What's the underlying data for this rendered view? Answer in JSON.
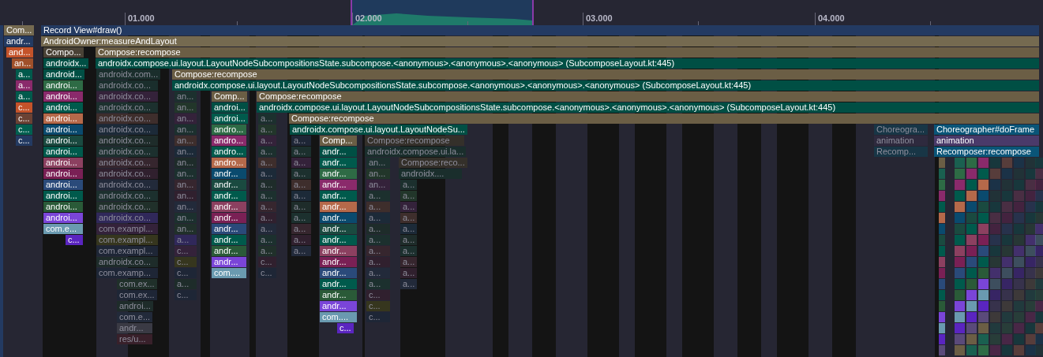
{
  "timeline": {
    "ticks": [
      "01.000",
      "02.000",
      "03.000",
      "04.000"
    ]
  },
  "columns": [
    {
      "frames": [
        {
          "label": "Com...",
          "color": "#756a50",
          "faded": false
        },
        {
          "label": "andr...",
          "color": "#233a62",
          "faded": false
        }
      ]
    },
    {
      "frames": [
        {
          "label": "Record View#draw()",
          "color": "#233a62",
          "faded": false
        },
        {
          "label": "AndroidOwner:measureAndLayout",
          "color": "#756a50",
          "faded": false
        }
      ]
    },
    {
      "frames": [
        {
          "label": "and...",
          "color": "#c4532a",
          "faded": false
        }
      ]
    },
    {
      "frames": [
        {
          "label": "an...",
          "color": "#a0502a",
          "faded": false
        }
      ]
    },
    {
      "frames": [
        {
          "label": "a...",
          "color": "#005a4c",
          "faded": false
        },
        {
          "label": "a...",
          "color": "#8a2a6b",
          "faded": false
        },
        {
          "label": "a...",
          "color": "#005a4c",
          "faded": false
        },
        {
          "label": "c...",
          "color": "#c4532a",
          "faded": false
        },
        {
          "label": "c...",
          "color": "#6b4234",
          "faded": false
        },
        {
          "label": "c...",
          "color": "#006050",
          "faded": false
        },
        {
          "label": "c...",
          "color": "#233a62",
          "faded": false
        }
      ]
    },
    {
      "frames": [
        {
          "label": "Compo...",
          "color": "#4a4236",
          "faded": false
        },
        {
          "label": "androidx...",
          "color": "#004f44",
          "faded": false
        },
        {
          "label": "android...",
          "color": "#004f44",
          "faded": false
        },
        {
          "label": "androi...",
          "color": "#2e6b45",
          "faded": false
        },
        {
          "label": "androi...",
          "color": "#8a2a6b",
          "faded": false
        },
        {
          "label": "androi...",
          "color": "#005a4c",
          "faded": false
        },
        {
          "label": "androi...",
          "color": "#b5694a",
          "faded": false
        },
        {
          "label": "androi...",
          "color": "#0a4a6e",
          "faded": false
        },
        {
          "label": "androi...",
          "color": "#1a4a40",
          "faded": false
        },
        {
          "label": "androi...",
          "color": "#005a4c",
          "faded": false
        },
        {
          "label": "androi...",
          "color": "#8c4060",
          "faded": false
        },
        {
          "label": "androi...",
          "color": "#7a2055",
          "faded": false
        },
        {
          "label": "androi...",
          "color": "#2a4a7a",
          "faded": false
        },
        {
          "label": "androi...",
          "color": "#005a4c",
          "faded": false
        },
        {
          "label": "androi...",
          "color": "#2a5a38",
          "faded": false
        },
        {
          "label": "androi...",
          "color": "#7a45d8",
          "faded": false
        },
        {
          "label": "com.e...",
          "color": "#6a9ab0",
          "faded": false
        }
      ]
    },
    {
      "frames": [
        {
          "label": "c...",
          "color": "#5a25c0",
          "faded": false
        }
      ]
    },
    {
      "frames": [
        {
          "label": "Compose:recompose",
          "color": "#6b5e45",
          "faded": false
        },
        {
          "label": "androidx.compose.ui.layout.LayoutNodeSubcompositionsState.subcompose.<anonymous>.<anonymous>.<anonymous> (SubcomposeLayout.kt:445)",
          "color": "#004f44",
          "faded": false
        }
      ]
    },
    {
      "frames": [
        {
          "label": "androidx.com...",
          "color": "#1a2e2c",
          "faded": true
        },
        {
          "label": "androidx.co...",
          "color": "#1a2e2c",
          "faded": true
        },
        {
          "label": "androidx.co...",
          "color": "#34223a",
          "faded": true
        },
        {
          "label": "androidx.co...",
          "color": "#1c302e",
          "faded": true
        },
        {
          "label": "androidx.co...",
          "color": "#3e2e2c",
          "faded": true
        },
        {
          "label": "androidx.co...",
          "color": "#1c2a38",
          "faded": true
        },
        {
          "label": "androidx.co...",
          "color": "#1e2c2a",
          "faded": true
        },
        {
          "label": "androidx.co...",
          "color": "#1c302e",
          "faded": true
        },
        {
          "label": "androidx.co...",
          "color": "#36262e",
          "faded": true
        },
        {
          "label": "androidx.co...",
          "color": "#30202e",
          "faded": true
        },
        {
          "label": "androidx.co...",
          "color": "#222a3a",
          "faded": true
        },
        {
          "label": "androidx.co...",
          "color": "#1c302e",
          "faded": true
        },
        {
          "label": "androidx.co...",
          "color": "#20302a",
          "faded": true
        },
        {
          "label": "androidx.co...",
          "color": "#30285a",
          "faded": true
        },
        {
          "label": "com.exampl...",
          "color": "#34223a",
          "faded": true
        },
        {
          "label": "com.exampl...",
          "color": "#36361e",
          "faded": true
        },
        {
          "label": "com.exampl...",
          "color": "#1e2636",
          "faded": true
        },
        {
          "label": "androidx.co...",
          "color": "#1e2c2a",
          "faded": true
        },
        {
          "label": "com.examp...",
          "color": "#1e2636",
          "faded": true
        }
      ]
    },
    {
      "frames": [
        {
          "label": "com.ex...",
          "color": "#20302a",
          "faded": true
        },
        {
          "label": "com.ex...",
          "color": "#1e2636",
          "faded": true
        },
        {
          "label": "androi...",
          "color": "#1e2c2a",
          "faded": true
        },
        {
          "label": "com.e...",
          "color": "#222a3a",
          "faded": true
        },
        {
          "label": "andr...",
          "color": "#3a3a44",
          "faded": true
        },
        {
          "label": "res/u...",
          "color": "#38202a",
          "faded": true
        }
      ]
    },
    {
      "frames": [
        {
          "label": "Compose:recompose",
          "color": "#6b5e45",
          "faded": false
        },
        {
          "label": "androidx.compose.ui.layout.LayoutNodeSubcompositionsState.subcompose.<anonymous>.<anonymous>.<anonymous> (SubcomposeLayout.kt:445)",
          "color": "#004f44",
          "faded": false
        }
      ]
    },
    {
      "frames": [
        {
          "label": "an...",
          "color": "#1c302e",
          "faded": true
        },
        {
          "label": "an...",
          "color": "#22362a",
          "faded": true
        },
        {
          "label": "an...",
          "color": "#34223a",
          "faded": true
        },
        {
          "label": "an...",
          "color": "#1c302e",
          "faded": true
        },
        {
          "label": "an...",
          "color": "#3e2e2c",
          "faded": true
        },
        {
          "label": "an...",
          "color": "#1c2a38",
          "faded": true
        },
        {
          "label": "an...",
          "color": "#1e2c2a",
          "faded": true
        },
        {
          "label": "an...",
          "color": "#1c302e",
          "faded": true
        },
        {
          "label": "an...",
          "color": "#36262e",
          "faded": true
        },
        {
          "label": "an...",
          "color": "#30202e",
          "faded": true
        },
        {
          "label": "an...",
          "color": "#222a3a",
          "faded": true
        },
        {
          "label": "an...",
          "color": "#1c302e",
          "faded": true
        },
        {
          "label": "an...",
          "color": "#20302a",
          "faded": true
        },
        {
          "label": "a...",
          "color": "#30285a",
          "faded": true
        },
        {
          "label": "c...",
          "color": "#34223a",
          "faded": true
        },
        {
          "label": "c...",
          "color": "#36361e",
          "faded": true
        },
        {
          "label": "c...",
          "color": "#1e2636",
          "faded": true
        },
        {
          "label": "a...",
          "color": "#1e2c2a",
          "faded": true
        },
        {
          "label": "c...",
          "color": "#1e2636",
          "faded": true
        }
      ]
    },
    {
      "frames": [
        {
          "label": "Comp...",
          "color": "#6b5e45",
          "faded": false
        },
        {
          "label": "androi...",
          "color": "#004f44",
          "faded": false
        },
        {
          "label": "androi...",
          "color": "#005a4c",
          "faded": false
        },
        {
          "label": "andro...",
          "color": "#2e6b45",
          "faded": false
        },
        {
          "label": "andro...",
          "color": "#8a2a6b",
          "faded": false
        },
        {
          "label": "andro...",
          "color": "#005a4c",
          "faded": false
        },
        {
          "label": "andro...",
          "color": "#b5694a",
          "faded": false
        },
        {
          "label": "andr...",
          "color": "#0a4a6e",
          "faded": false
        },
        {
          "label": "andr...",
          "color": "#1a4a40",
          "faded": false
        },
        {
          "label": "andr...",
          "color": "#005a4c",
          "faded": false
        },
        {
          "label": "andr...",
          "color": "#8c4060",
          "faded": false
        },
        {
          "label": "andr...",
          "color": "#7a2055",
          "faded": false
        },
        {
          "label": "andr...",
          "color": "#2a4a7a",
          "faded": false
        },
        {
          "label": "andr...",
          "color": "#005a4c",
          "faded": false
        },
        {
          "label": "andr...",
          "color": "#2a5a38",
          "faded": false
        },
        {
          "label": "andr...",
          "color": "#7a45d8",
          "faded": false
        },
        {
          "label": "com....",
          "color": "#6a9ab0",
          "faded": false
        }
      ]
    },
    {
      "frames": [
        {
          "label": "Compose:recompose",
          "color": "#6b5e45",
          "faded": false
        },
        {
          "label": "androidx.compose.ui.layout.LayoutNodeSubcompositionsState.subcompose.<anonymous>.<anonymous>.<anonymous> (SubcomposeLayout.kt:445)",
          "color": "#004f44",
          "faded": false
        }
      ]
    },
    {
      "frames": [
        {
          "label": "a...",
          "color": "#1c302e",
          "faded": true
        },
        {
          "label": "a...",
          "color": "#22362a",
          "faded": true
        },
        {
          "label": "a...",
          "color": "#34223a",
          "faded": true
        },
        {
          "label": "a...",
          "color": "#1c302e",
          "faded": true
        },
        {
          "label": "a...",
          "color": "#3e2e2c",
          "faded": true
        },
        {
          "label": "a...",
          "color": "#1c2a38",
          "faded": true
        },
        {
          "label": "a...",
          "color": "#1e2c2a",
          "faded": true
        },
        {
          "label": "a...",
          "color": "#1c302e",
          "faded": true
        },
        {
          "label": "a...",
          "color": "#36262e",
          "faded": true
        },
        {
          "label": "a...",
          "color": "#30202e",
          "faded": true
        },
        {
          "label": "a...",
          "color": "#222a3a",
          "faded": true
        },
        {
          "label": "a...",
          "color": "#1c302e",
          "faded": true
        },
        {
          "label": "a...",
          "color": "#20302a",
          "faded": true
        },
        {
          "label": "c...",
          "color": "#30202e",
          "faded": true
        },
        {
          "label": "c...",
          "color": "#1e2636",
          "faded": true
        }
      ]
    },
    {
      "frames": [
        {
          "label": "Compose:recompose",
          "color": "#6b5e45",
          "faded": false
        }
      ]
    },
    {
      "frames": [
        {
          "label": "androidx.compose.ui.layout.LayoutNodeSu...",
          "color": "#004f44",
          "faded": false
        }
      ]
    },
    {
      "frames": [
        {
          "label": "a...",
          "color": "#1e2636",
          "faded": true
        },
        {
          "label": "a...",
          "color": "#1c302e",
          "faded": true
        },
        {
          "label": "a...",
          "color": "#34223a",
          "faded": true
        },
        {
          "label": "a...",
          "color": "#1c302e",
          "faded": true
        },
        {
          "label": "a...",
          "color": "#3e2e2c",
          "faded": true
        },
        {
          "label": "a...",
          "color": "#1c2a38",
          "faded": true
        },
        {
          "label": "a...",
          "color": "#1e2c2a",
          "faded": true
        },
        {
          "label": "a...",
          "color": "#1c302e",
          "faded": true
        },
        {
          "label": "a...",
          "color": "#36262e",
          "faded": true
        },
        {
          "label": "a...",
          "color": "#30202e",
          "faded": true
        },
        {
          "label": "a...",
          "color": "#222a3a",
          "faded": true
        }
      ]
    },
    {
      "frames": [
        {
          "label": "Comp...",
          "color": "#6b5e45",
          "faded": false
        },
        {
          "label": "andr...",
          "color": "#004f44",
          "faded": false
        },
        {
          "label": "andr...",
          "color": "#005a4c",
          "faded": false
        },
        {
          "label": "andr...",
          "color": "#2e6b45",
          "faded": false
        },
        {
          "label": "andr...",
          "color": "#8a2a6b",
          "faded": false
        },
        {
          "label": "andr...",
          "color": "#005a4c",
          "faded": false
        },
        {
          "label": "andr...",
          "color": "#b5694a",
          "faded": false
        },
        {
          "label": "andr...",
          "color": "#0a4a6e",
          "faded": false
        },
        {
          "label": "andr...",
          "color": "#1a4a40",
          "faded": false
        },
        {
          "label": "andr...",
          "color": "#005a4c",
          "faded": false
        },
        {
          "label": "andr...",
          "color": "#8c4060",
          "faded": false
        },
        {
          "label": "andr...",
          "color": "#7a2055",
          "faded": false
        },
        {
          "label": "andr...",
          "color": "#2a4a7a",
          "faded": false
        },
        {
          "label": "andr...",
          "color": "#005a4c",
          "faded": false
        },
        {
          "label": "andr...",
          "color": "#2a5a38",
          "faded": false
        },
        {
          "label": "andr...",
          "color": "#7a45d8",
          "faded": false
        },
        {
          "label": "com....",
          "color": "#6a9ab0",
          "faded": false
        }
      ]
    },
    {
      "frames": [
        {
          "label": "c...",
          "color": "#5a25c0",
          "faded": false
        }
      ]
    },
    {
      "frames": [
        {
          "label": "Compose:recompose",
          "color": "#34302a",
          "faded": true
        },
        {
          "label": "androidx.compose.ui.la...",
          "color": "#1a2e2c",
          "faded": true
        }
      ]
    },
    {
      "frames": [
        {
          "label": "an...",
          "color": "#1c302e",
          "faded": true
        },
        {
          "label": "an...",
          "color": "#22362a",
          "faded": true
        },
        {
          "label": "an...",
          "color": "#34223a",
          "faded": true
        },
        {
          "label": "a...",
          "color": "#1c302e",
          "faded": true
        },
        {
          "label": "a...",
          "color": "#3e2e2c",
          "faded": true
        },
        {
          "label": "a...",
          "color": "#1c2a38",
          "faded": true
        },
        {
          "label": "a...",
          "color": "#1e2c2a",
          "faded": true
        },
        {
          "label": "a...",
          "color": "#1c302e",
          "faded": true
        },
        {
          "label": "a...",
          "color": "#36262e",
          "faded": true
        },
        {
          "label": "a...",
          "color": "#30202e",
          "faded": true
        },
        {
          "label": "a...",
          "color": "#222a3a",
          "faded": true
        },
        {
          "label": "a...",
          "color": "#1c302e",
          "faded": true
        },
        {
          "label": "c...",
          "color": "#30202e",
          "faded": true
        },
        {
          "label": "c...",
          "color": "#36361e",
          "faded": true
        },
        {
          "label": "c...",
          "color": "#1e2636",
          "faded": true
        }
      ]
    },
    {
      "frames": [
        {
          "label": "Compose:reco...",
          "color": "#34302a",
          "faded": true
        },
        {
          "label": "androidx....",
          "color": "#1a2e2c",
          "faded": true
        }
      ]
    },
    {
      "frames": [
        {
          "label": "a...",
          "color": "#1c302e",
          "faded": true
        },
        {
          "label": "a...",
          "color": "#22362a",
          "faded": true
        },
        {
          "label": "a...",
          "color": "#34223a",
          "faded": true
        },
        {
          "label": "a...",
          "color": "#3e2e2c",
          "faded": true
        },
        {
          "label": "a...",
          "color": "#1c2a38",
          "faded": true
        },
        {
          "label": "a...",
          "color": "#1e2c2a",
          "faded": true
        },
        {
          "label": "a...",
          "color": "#1c302e",
          "faded": true
        },
        {
          "label": "a...",
          "color": "#36262e",
          "faded": true
        },
        {
          "label": "a...",
          "color": "#30202e",
          "faded": true
        },
        {
          "label": "a...",
          "color": "#222a3a",
          "faded": true
        }
      ]
    },
    {
      "frames": [
        {
          "label": "Choreogra...",
          "color": "#183646",
          "faded": true
        },
        {
          "label": "animation",
          "color": "#2e2a3e",
          "faded": true
        },
        {
          "label": "Recomp...",
          "color": "#183646",
          "faded": true
        }
      ]
    },
    {
      "frames": [
        {
          "label": "Choreographer#doFrame",
          "color": "#0a5578",
          "faded": false
        },
        {
          "label": "animation",
          "color": "#4a3a6a",
          "faded": false
        },
        {
          "label": "Recomposer:recompose",
          "color": "#0a5578",
          "faded": false
        }
      ]
    }
  ]
}
